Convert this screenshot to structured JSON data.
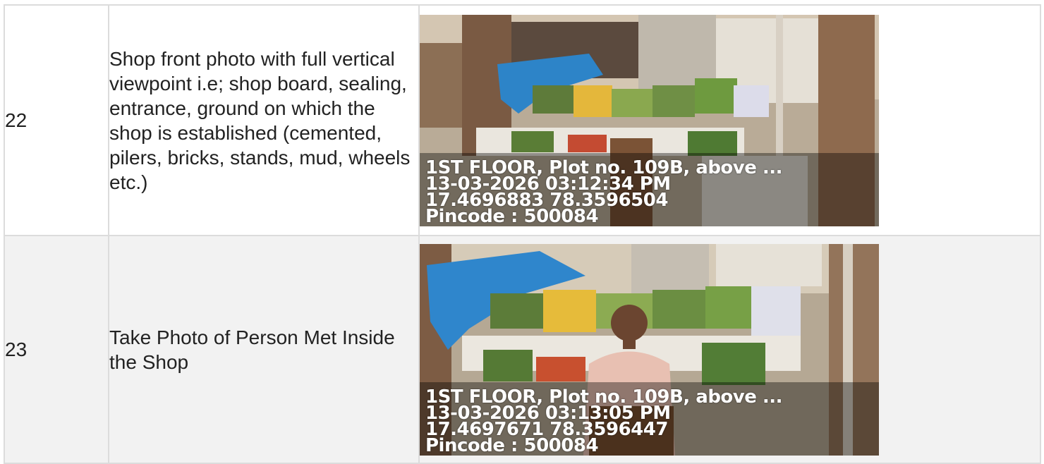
{
  "rows": [
    {
      "sl": "22",
      "description": "Shop front photo with full vertical viewpoint i.e; shop board, sealing, entrance, ground on which the shop is established (cemented, pilers, bricks, stands, mud, wheels etc.)",
      "photo": {
        "address": "1ST FLOOR, Plot no. 109B, above ...",
        "datetime": "13-03-2026 03:12:34 PM",
        "coordinates": "17.4696883 78.3596504",
        "pincode": "Pincode : 500084"
      }
    },
    {
      "sl": "23",
      "description": "Take Photo of Person Met Inside the Shop",
      "photo": {
        "address": "1ST FLOOR, Plot no. 109B, above ...",
        "datetime": "13-03-2026 03:13:05 PM",
        "coordinates": "17.4697671 78.3596447",
        "pincode": "Pincode : 500084"
      }
    }
  ]
}
